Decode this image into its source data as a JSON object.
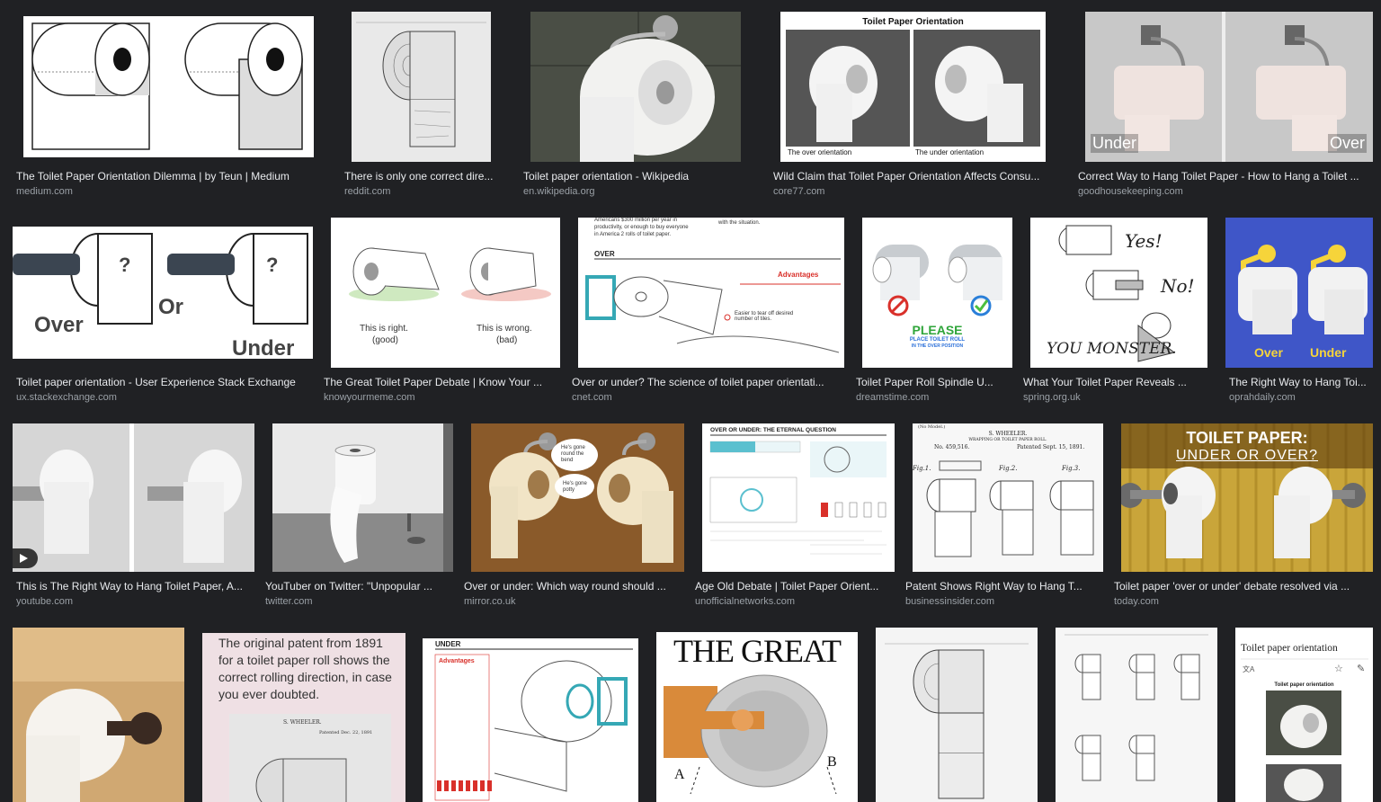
{
  "results": [
    {
      "title": "The Toilet Paper Orientation Dilemma | by Teun | Medium",
      "source": "medium.com"
    },
    {
      "title": "There is only one correct dire...",
      "source": "reddit.com"
    },
    {
      "title": "Toilet paper orientation - Wikipedia",
      "source": "en.wikipedia.org"
    },
    {
      "title": "Wild Claim that Toilet Paper Orientation Affects Consu...",
      "source": "core77.com",
      "overlay": {
        "heading": "Toilet Paper Orientation",
        "left": "The over orientation",
        "right": "The under orientation"
      }
    },
    {
      "title": "Correct Way to Hang Toilet Paper - How to Hang a Toilet ...",
      "source": "goodhousekeeping.com",
      "overlay": {
        "left": "Under",
        "right": "Over"
      }
    },
    {
      "title": "Toilet paper orientation - User Experience Stack Exchange",
      "source": "ux.stackexchange.com",
      "overlay": {
        "over": "Over",
        "or": "Or",
        "under": "Under",
        "q": "?"
      }
    },
    {
      "title": "The Great Toilet Paper Debate | Know Your ...",
      "source": "knowyourmeme.com",
      "overlay": {
        "right": "This is right.",
        "good": "(good)",
        "wrong": "This is wrong.",
        "bad": "(bad)"
      }
    },
    {
      "title": "Over or under? The science of toilet paper orientati...",
      "source": "cnet.com",
      "overlay": {
        "over": "OVER",
        "adv": "Advantages",
        "top1": "Americans $300 million per year in",
        "top2": "productivity, or enough to buy everyone",
        "top3": "in America 2 rolls of toilet paper.",
        "side": "with the situation.",
        "note": "Easier to tear off desired number of tiles."
      }
    },
    {
      "title": "Toilet Paper Roll Spindle U...",
      "source": "dreamstime.com",
      "overlay": {
        "please": "PLEASE",
        "line1": "PLACE TOILET ROLL",
        "line2": "IN THE OVER POSITION"
      }
    },
    {
      "title": "What Your Toilet Paper Reveals ...",
      "source": "spring.org.uk",
      "overlay": {
        "yes": "Yes!",
        "no": "No!",
        "monster": "YOU MONSTER."
      }
    },
    {
      "title": "The Right Way to Hang Toi...",
      "source": "oprahdaily.com",
      "overlay": {
        "over": "Over",
        "under": "Under"
      }
    },
    {
      "title": "This is The Right Way to Hang Toilet Paper, A...",
      "source": "youtube.com"
    },
    {
      "title": "YouTuber on Twitter: \"Unpopular ...",
      "source": "twitter.com"
    },
    {
      "title": "Over or under: Which way round should ...",
      "source": "mirror.co.uk",
      "overlay": {
        "b1": "He's gone",
        "b2": "round the",
        "b3": "bend",
        "c1": "He's gone",
        "c2": "potty"
      }
    },
    {
      "title": "Age Old Debate | Toilet Paper Orient...",
      "source": "unofficialnetworks.com",
      "overlay": {
        "heading": "OVER OR UNDER: THE ETERNAL QUESTION"
      }
    },
    {
      "title": "Patent Shows Right Way to Hang T...",
      "source": "businessinsider.com",
      "overlay": {
        "model": "(No Model.)",
        "name": "S. WHEELER.",
        "sub": "WRAPPING OR TOILET PAPER ROLL.",
        "no": "No. 459,516.",
        "date": "Patented Sept. 15, 1891.",
        "f1": "Fig.1.",
        "f2": "Fig.2.",
        "f3": "Fig.3."
      }
    },
    {
      "title": "Toilet paper 'over or under' debate resolved via ...",
      "source": "today.com",
      "overlay": {
        "h1": "TOILET PAPER:",
        "h2": "UNDER OR OVER?"
      }
    },
    {
      "overlay": {}
    },
    {
      "overlay": {
        "l1": "The original patent from 1891",
        "l2": "for a toilet paper roll shows the",
        "l3": "correct rolling direction, in case",
        "l4": "you ever doubted.",
        "name": "S. WHEELER.",
        "date": "Patented Dec. 22, 1891"
      }
    },
    {
      "overlay": {
        "under": "UNDER",
        "adv": "Advantages"
      }
    },
    {
      "overlay": {
        "title": "THE GREAT",
        "a": "A",
        "b": "B"
      }
    },
    {
      "overlay": {}
    },
    {
      "overlay": {}
    },
    {
      "overlay": {
        "title": "Toilet paper orientation",
        "caption": "Toilet paper orientation"
      }
    }
  ],
  "colors": {
    "background": "#202124",
    "caption": "#e8eaed",
    "source": "#9aa0a6",
    "oprah_bg": "#3f56c8",
    "today_bg": "#c9a53a"
  }
}
